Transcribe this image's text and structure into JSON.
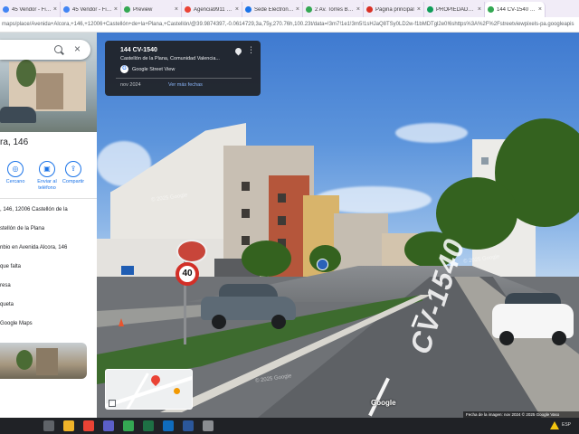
{
  "browser": {
    "tabs": [
      {
        "label": "45 Vendor - FinSo",
        "fav": "#4285f4",
        "active": false
      },
      {
        "label": "45 Vendor - FinSo",
        "fav": "#4285f4",
        "active": false
      },
      {
        "label": "Preview",
        "fav": "#34a853",
        "active": false
      },
      {
        "label": "Agencia9911 Usu",
        "fav": "#ea4335",
        "active": false
      },
      {
        "label": "Sede Electronica -",
        "fav": "#1a73e8",
        "active": false
      },
      {
        "label": "2 Av. Torres Bellot",
        "fav": "#34a853",
        "active": false
      },
      {
        "label": "Página principal",
        "fav": "#d93025",
        "active": false
      },
      {
        "label": "PROPIEDADES -",
        "fav": "#0f9d58",
        "active": false
      },
      {
        "label": "144 CV-1540 - G",
        "fav": "#34a853",
        "active": true
      }
    ],
    "url": "maps/place/Avenida+Alcora,+146,+12006+Castellón+de+la+Plana,+Castellón/@39.9874397,-0.0614729,3a,75y,270.76h,100.23t/data=!3m7!1e1!3m5!1sHJaQ8TSy0LD2w-f1bMDTgl2e0!6shttps%3A%2F%2Fstreetviewpixels-pa.googleapis"
  },
  "panel": {
    "title": "ra, 146",
    "actions": [
      {
        "icon": "nearby-icon",
        "glyph": "◎",
        "label": "Cercano"
      },
      {
        "icon": "send-to-phone-icon",
        "glyph": "▣",
        "label": "Enviar al teléfono"
      },
      {
        "icon": "share-icon",
        "glyph": "⇪",
        "label": "Compartir"
      }
    ],
    "info": [
      ", 146, 12006 Castellón de la",
      "stellón de la Plana",
      "nbio en Avenida Alcora, 146",
      "que falta",
      "resa",
      "queta",
      "Google Maps"
    ]
  },
  "card": {
    "title": "144 CV-1540",
    "subtitle": "Castellón de la Plana, Comunidad Valencia...",
    "source": "Google Street View",
    "date": "nov 2024",
    "more_dates": "Ver más fechas"
  },
  "streetview": {
    "sign_speed": "40",
    "road_marking": "CV-1540",
    "watermarks": [
      "© 2025 Google",
      "© 2025 Google",
      "© 2025 Google"
    ],
    "google_label": "Google",
    "footer": "Fecha de la imagen: nov 2024   © 2025 Google   Vaso"
  },
  "taskbar": {
    "icons": [
      {
        "name": "taskview-icon",
        "color": "#5f6368"
      },
      {
        "name": "file-explorer-icon",
        "color": "#f0b429"
      },
      {
        "name": "chrome-icon",
        "color": "#ea4335"
      },
      {
        "name": "teams-icon",
        "color": "#5b5fc7"
      },
      {
        "name": "chrome-profile-icon",
        "color": "#34a853"
      },
      {
        "name": "excel-icon",
        "color": "#1e7145"
      },
      {
        "name": "outlook-icon",
        "color": "#0f6cbd"
      },
      {
        "name": "word-icon",
        "color": "#2b579a"
      },
      {
        "name": "app-icon",
        "color": "#8a8d91"
      }
    ],
    "tray": "ESP"
  }
}
